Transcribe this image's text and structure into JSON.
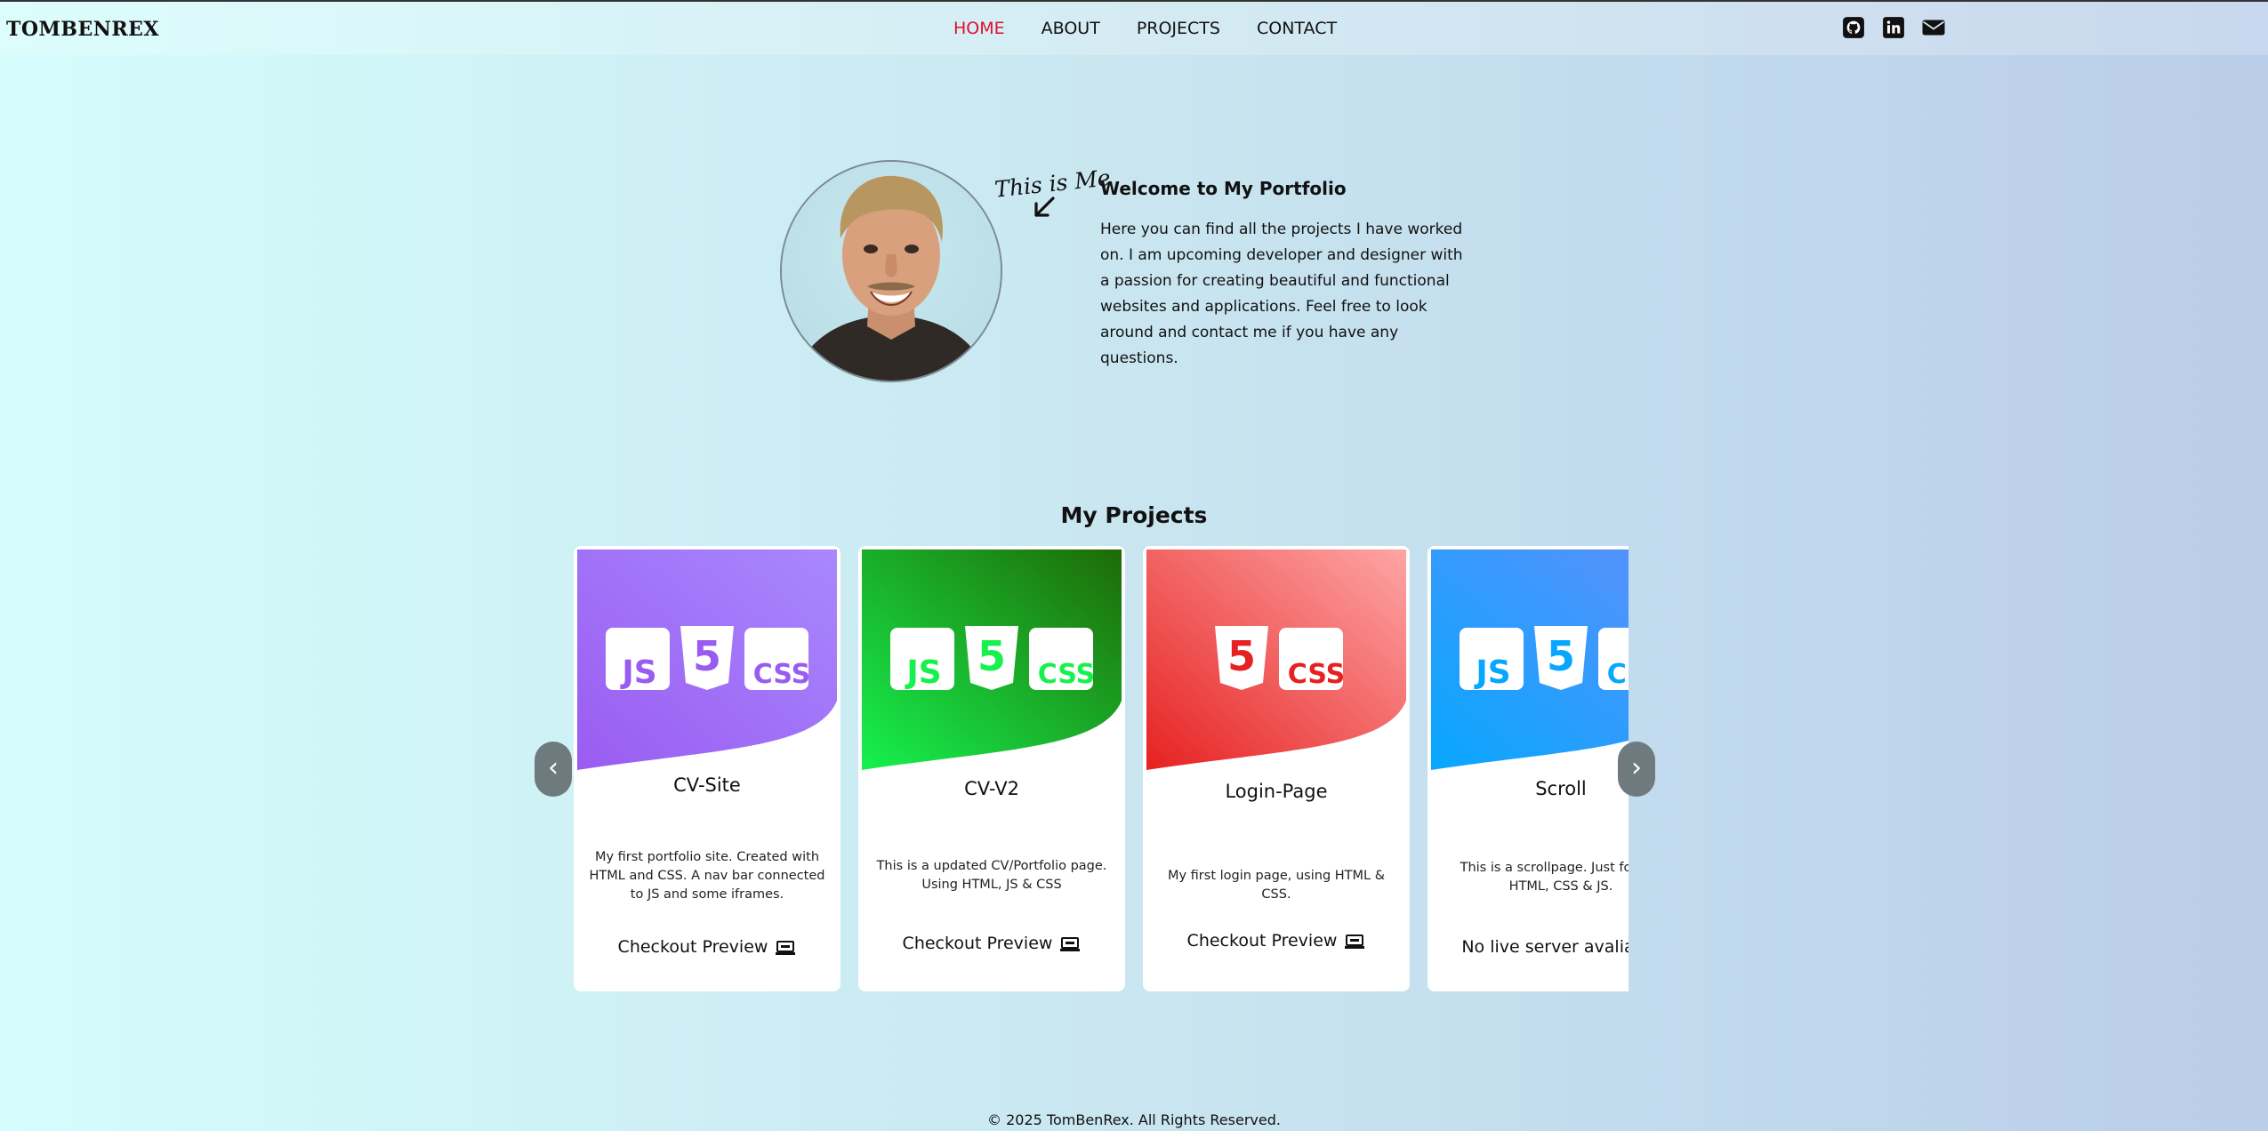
{
  "nav": {
    "brand": "TOMBENREX",
    "links": [
      {
        "label": "HOME",
        "active": true
      },
      {
        "label": "ABOUT"
      },
      {
        "label": "PROJECTS"
      },
      {
        "label": "CONTACT"
      }
    ],
    "social_icons": [
      "github-icon",
      "linkedin-icon",
      "mail-icon"
    ],
    "active_color": "#e0102f"
  },
  "hero": {
    "tag": "This is Me",
    "title": "Welcome to My Portfolio",
    "text": "Here you can find all the projects I have worked on. I am upcoming developer and designer with a passion for creating beautiful and functional websites and applications. Feel free to look around and contact me if you have any questions."
  },
  "projects": {
    "title": "My Projects",
    "prev_label": "‹",
    "next_label": "›",
    "cards": [
      {
        "name": "CV-Site",
        "desc": "My first portfolio site. Created with HTML and CSS. A nav bar connected to JS and some iframes.",
        "link": "Checkout Preview",
        "badges": [
          "JS",
          "5",
          "CSS"
        ],
        "colors": [
          "#9a5cf0",
          "#a888ff"
        ]
      },
      {
        "name": "CV-V2",
        "desc": "This is a updated CV/Portfolio page. Using HTML, JS & CSS",
        "link": "Checkout Preview",
        "badges": [
          "JS",
          "5",
          "CSS"
        ],
        "colors": [
          "#16f14e",
          "#1e6a06"
        ]
      },
      {
        "name": "Login-Page",
        "desc": "My first login page, using HTML & CSS.",
        "link": "Checkout Preview",
        "badges": [
          "5",
          "CSS"
        ],
        "colors": [
          "#e62121",
          "#fea5a5"
        ]
      },
      {
        "name": "Scroll",
        "desc": "This is a scrollpage. Just for fun HTML, CSS & JS.",
        "link": "No live server avaliable",
        "badges": [
          "JS",
          "5",
          "CSS"
        ],
        "colors": [
          "#07a7fe",
          "#5e8ffc"
        ]
      }
    ]
  },
  "footer": {
    "text": "© 2025 TomBenRex. All Rights Reserved."
  }
}
